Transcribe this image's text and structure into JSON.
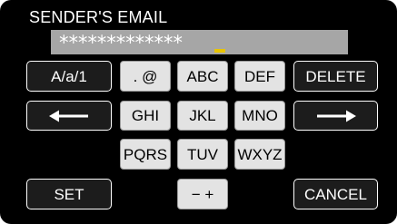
{
  "title": "SENDER'S EMAIL",
  "input": {
    "value": "*************"
  },
  "keys": {
    "case": "A/a/1",
    "sym": ". @",
    "abc": "ABC",
    "def": "DEF",
    "delete": "DELETE",
    "ghi": "GHI",
    "jkl": "JKL",
    "mno": "MNO",
    "pqrs": "PQRS",
    "tuv": "TUV",
    "wxyz": "WXYZ",
    "set": "SET",
    "minus_plus": "− +",
    "cancel": "CANCEL",
    "left_arrow_icon": "arrow-left-icon",
    "right_arrow_icon": "arrow-right-icon"
  },
  "colors": {
    "cursor": "#e8c400",
    "field": "#a6a6a6"
  }
}
